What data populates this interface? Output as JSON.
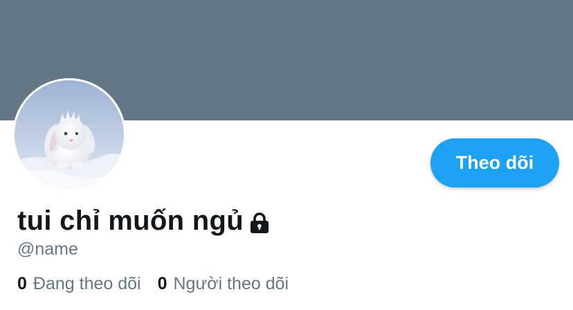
{
  "profile": {
    "display_name": "tui chỉ muốn ngủ",
    "handle": "@name",
    "follow_label": "Theo dõi",
    "locked_icon": "lock-icon",
    "avatar_icon": "avatar-white-bunny-in-snow"
  },
  "stats": {
    "following_count": "0",
    "following_label": "Đang theo dõi",
    "followers_count": "0",
    "followers_label": "Người theo dõi"
  },
  "colors": {
    "banner": "#657786",
    "accent": "#1da1f2",
    "text_primary": "#14171a",
    "text_secondary": "#657786"
  }
}
